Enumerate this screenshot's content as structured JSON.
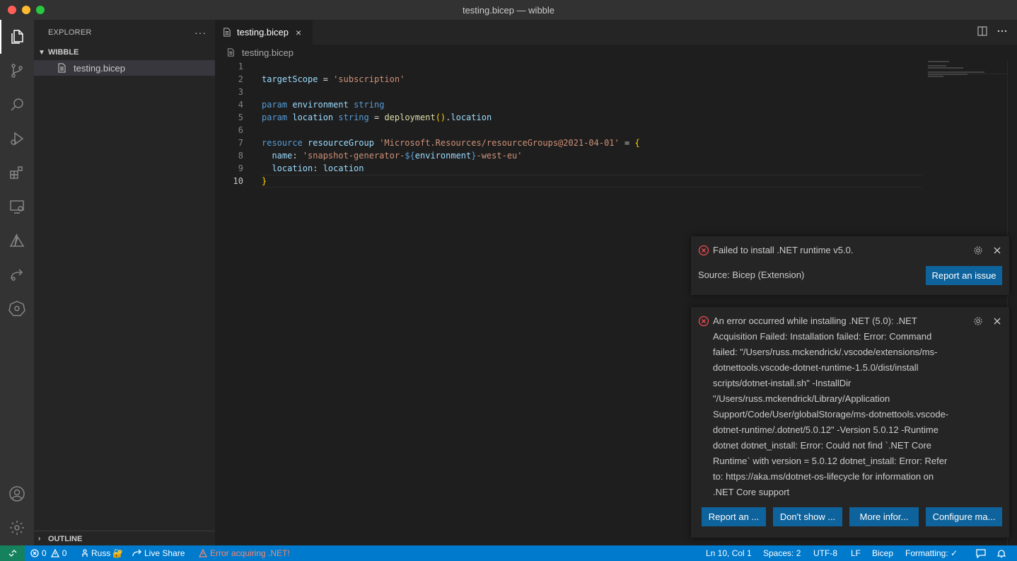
{
  "window": {
    "title": "testing.bicep — wibble"
  },
  "sidebar": {
    "title": "EXPLORER",
    "more": "···",
    "folder": "WIBBLE",
    "files": [
      "testing.bicep"
    ],
    "outline": "OUTLINE"
  },
  "tabs": [
    {
      "label": "testing.bicep",
      "close": "×"
    }
  ],
  "breadcrumb": "testing.bicep",
  "editor": {
    "line_numbers": [
      "1",
      "2",
      "3",
      "4",
      "5",
      "6",
      "7",
      "8",
      "9",
      "10"
    ],
    "lines": [
      "targetScope = 'subscription'",
      "",
      "param environment string",
      "param location string = deployment().location",
      "",
      "resource resourceGroup 'Microsoft.Resources/resourceGroups@2021-04-01' = {",
      "  name: 'snapshot-generator-${environment}-west-eu'",
      "  location: location",
      "}",
      ""
    ]
  },
  "notifications": [
    {
      "message": "Failed to install .NET runtime v5.0.",
      "source": "Source: Bicep (Extension)",
      "buttons": [
        "Report an issue"
      ]
    },
    {
      "message_lines": [
        "An error occurred while installing .NET (5.0): .NET",
        "Acquisition Failed: Installation failed: Error: Command",
        "failed: \"/Users/russ.mckendrick/.vscode/extensions/ms-",
        "dotnettools.vscode-dotnet-runtime-1.5.0/dist/install",
        "scripts/dotnet-install.sh\" -InstallDir",
        "\"/Users/russ.mckendrick/Library/Application",
        "Support/Code/User/globalStorage/ms-dotnettools.vscode-",
        "dotnet-runtime/.dotnet/5.0.12\" -Version 5.0.12 -Runtime",
        "dotnet dotnet_install: Error: Could not find `.NET Core",
        "Runtime` with version = 5.0.12 dotnet_install: Error: Refer",
        "to: https://aka.ms/dotnet-os-lifecycle for information on",
        ".NET Core support"
      ],
      "buttons": [
        "Report an ...",
        "Don't show ...",
        "More infor...",
        "Configure ma..."
      ]
    }
  ],
  "statusbar": {
    "errors": "0",
    "warnings": "0",
    "user": "Russ",
    "live_share": "Live Share",
    "error_message": "Error acquiring .NET!",
    "position": "Ln 10, Col 1",
    "spaces": "Spaces: 2",
    "encoding": "UTF-8",
    "eol": "LF",
    "language": "Bicep",
    "formatting": "Formatting: ✓"
  },
  "colors": {
    "accent": "#007acc",
    "button": "#0e639c",
    "error": "#f14c4c",
    "remote": "#16825d"
  }
}
